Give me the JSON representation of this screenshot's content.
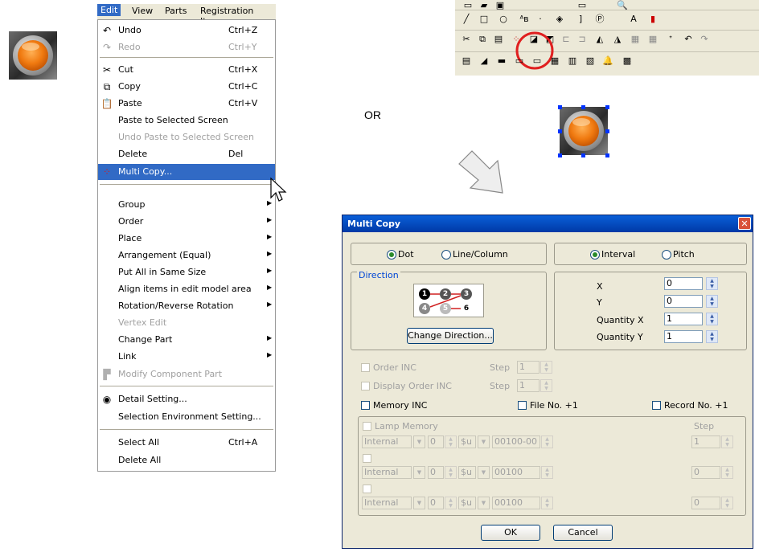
{
  "menubar": {
    "items": [
      "Edit",
      "View",
      "Parts",
      "Registration Item"
    ]
  },
  "menu": {
    "items": [
      {
        "label": "Undo",
        "shortcut": "Ctrl+Z",
        "icon": "undo-icon",
        "disabled": false
      },
      {
        "label": "Redo",
        "shortcut": "Ctrl+Y",
        "icon": "redo-icon",
        "disabled": true
      },
      {
        "label": "Cut",
        "shortcut": "Ctrl+X",
        "icon": "cut-icon",
        "disabled": false
      },
      {
        "label": "Copy",
        "shortcut": "Ctrl+C",
        "icon": "copy-icon",
        "disabled": false
      },
      {
        "label": "Paste",
        "shortcut": "Ctrl+V",
        "icon": "paste-icon",
        "disabled": false
      },
      {
        "label": "Paste to Selected Screen",
        "shortcut": "",
        "disabled": false
      },
      {
        "label": "Undo Paste to Selected Screen",
        "shortcut": "",
        "disabled": true
      },
      {
        "label": "Delete",
        "shortcut": "Del",
        "disabled": false
      },
      {
        "label": "Multi Copy...",
        "shortcut": "",
        "icon": "multi-copy-icon",
        "highlighted": true
      },
      {
        "label": "Group",
        "submenu": true
      },
      {
        "label": "Order",
        "submenu": true
      },
      {
        "label": "Place",
        "submenu": true
      },
      {
        "label": "Arrangement (Equal)",
        "submenu": true
      },
      {
        "label": "Put All in Same Size",
        "submenu": true
      },
      {
        "label": "Align items in edit model area",
        "submenu": true
      },
      {
        "label": "Rotation/Reverse Rotation",
        "submenu": true
      },
      {
        "label": "Vertex Edit",
        "disabled": true
      },
      {
        "label": "Change Part",
        "submenu": true
      },
      {
        "label": "Link",
        "submenu": true
      },
      {
        "label": "Modify Component Part",
        "icon": "modify-component-icon",
        "disabled": true
      },
      {
        "label": "Detail Setting...",
        "icon": "detail-setting-icon"
      },
      {
        "label": "Selection Environment Setting..."
      },
      {
        "label": "Select All",
        "shortcut": "Ctrl+A"
      },
      {
        "label": "Delete All"
      }
    ]
  },
  "or_label": "OR",
  "dialog": {
    "title": "Multi Copy",
    "close": "✕",
    "dot_label": "Dot",
    "line_column_label": "Line/Column",
    "interval_label": "Interval",
    "pitch_label": "Pitch",
    "direction_label": "Direction",
    "direction_numbers": [
      "1",
      "2",
      "3",
      "4",
      "5",
      "6"
    ],
    "change_direction_label": "Change Direction...",
    "x_label": "X",
    "x_value": "0",
    "y_label": "Y",
    "y_value": "0",
    "qx_label": "Quantity X",
    "qx_value": "1",
    "qy_label": "Quantity Y",
    "qy_value": "1",
    "order_inc_label": "Order INC",
    "display_order_inc_label": "Display Order INC",
    "step_label": "Step",
    "step_value1": "1",
    "step_value2": "1",
    "memory_inc_label": "Memory INC",
    "file_no_label": "File No. +1",
    "record_no_label": "Record No. +1",
    "lamp_memory_label": "Lamp Memory",
    "step_col_label": "Step",
    "rows": [
      {
        "type": "Internal",
        "num": "0",
        "unit": "$u",
        "addr": "00100-00",
        "step": "1"
      },
      {
        "type": "Internal",
        "num": "0",
        "unit": "$u",
        "addr": "00100",
        "step": "0"
      },
      {
        "type": "Internal",
        "num": "0",
        "unit": "$u",
        "addr": "00100",
        "step": "0"
      }
    ],
    "ok_label": "OK",
    "cancel_label": "Cancel"
  },
  "colors": {
    "accent": "#316ac5",
    "title": "#0a5fd8",
    "lamp": "#f07a10",
    "circle": "#e02020",
    "arrow": "#d8d8d8"
  }
}
